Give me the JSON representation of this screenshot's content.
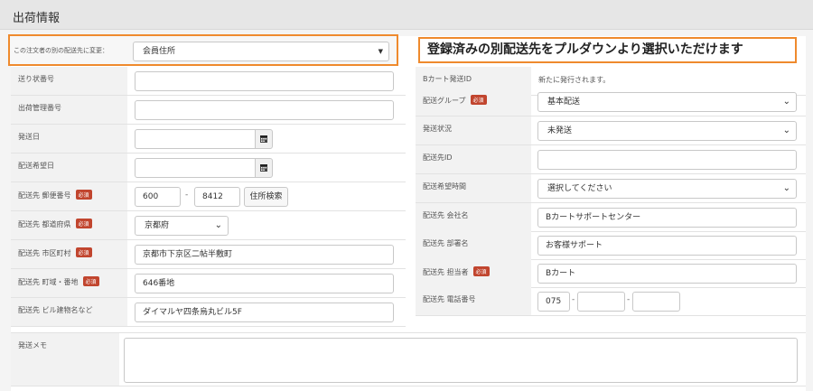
{
  "header": {
    "title": "出荷情報"
  },
  "member_select": {
    "label": "この注文者の別の配送先に変更：",
    "value": "会員住所"
  },
  "callout": {
    "text": "登録済みの別配送先をプルダウンより選択いただけます"
  },
  "badge_text": "必須",
  "left": {
    "tracking_no": {
      "label": "送り状番号",
      "value": ""
    },
    "shipment_no": {
      "label": "出荷管理番号",
      "value": ""
    },
    "ship_date": {
      "label": "発送日",
      "value": ""
    },
    "wish_date": {
      "label": "配送希望日",
      "value": ""
    },
    "postal": {
      "label": "配送先 郵便番号",
      "zip1": "600",
      "zip2": "8412",
      "search_label": "住所検索"
    },
    "pref": {
      "label": "配送先 都道府県",
      "value": "京都府"
    },
    "city": {
      "label": "配送先 市区町村",
      "value": "京都市下京区二帖半敷町"
    },
    "town": {
      "label": "配送先 町域・番地",
      "value": "646番地"
    },
    "building": {
      "label": "配送先 ビル建物名など",
      "value": "ダイマルヤ四条烏丸ビル5F"
    }
  },
  "right": {
    "bcart_id": {
      "label": "Bカート発送ID",
      "value": "新たに発行されます。"
    },
    "group": {
      "label": "配送グループ",
      "value": "基本配送"
    },
    "status": {
      "label": "発送状況",
      "value": "未発送"
    },
    "dest_id": {
      "label": "配送先ID",
      "value": ""
    },
    "wish_time": {
      "label": "配送希望時間",
      "value": "選択してください"
    },
    "company": {
      "label": "配送先 会社名",
      "value": "Bカートサポートセンター"
    },
    "department": {
      "label": "配送先 部署名",
      "value": "お客様サポート"
    },
    "person": {
      "label": "配送先 担当者",
      "value": "Bカート"
    },
    "phone": {
      "label": "配送先 電話番号",
      "tel1": "075",
      "tel2": "",
      "tel3": ""
    }
  },
  "memo": {
    "label": "発送メモ",
    "value": ""
  }
}
